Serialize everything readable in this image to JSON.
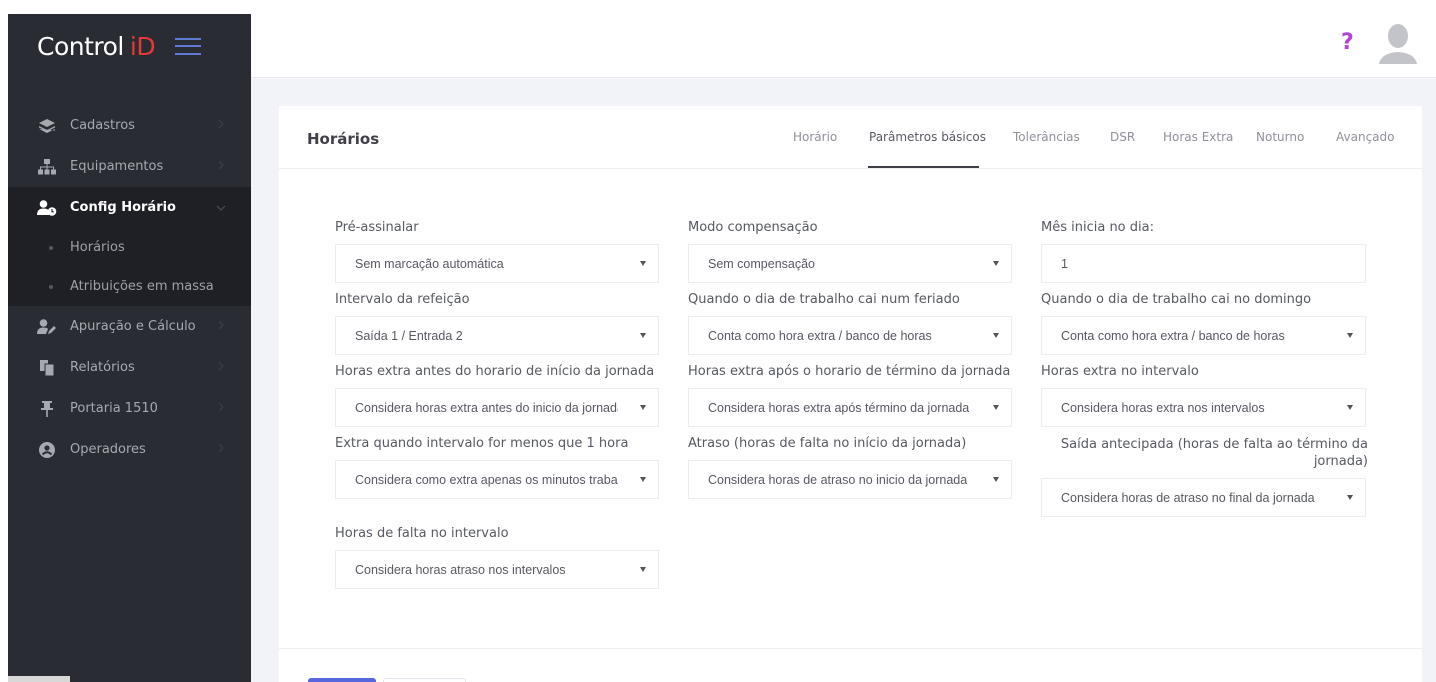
{
  "brand": {
    "name": "Control",
    "accent": "iD"
  },
  "sidebar": {
    "items": [
      {
        "label": "Cadastros",
        "icon": "layers-icon"
      },
      {
        "label": "Equipamentos",
        "icon": "sitemap-icon"
      },
      {
        "label": "Config Horário",
        "icon": "user-clock-icon"
      },
      {
        "label": "Apuração e Cálculo",
        "icon": "user-edit-icon"
      },
      {
        "label": "Relatórios",
        "icon": "copy-icon"
      },
      {
        "label": "Portaria 1510",
        "icon": "pin-icon"
      },
      {
        "label": "Operadores",
        "icon": "user-circle-icon"
      }
    ],
    "subitems": [
      {
        "label": "Horários"
      },
      {
        "label": "Atribuições em massa"
      }
    ]
  },
  "topbar": {
    "help": "?"
  },
  "card": {
    "title": "Horários",
    "tabs": [
      "Horário",
      "Parâmetros básicos",
      "Tolerâncias",
      "DSR",
      "Horas Extra",
      "Noturno",
      "Avançado"
    ],
    "active_tab": "Parâmetros básicos"
  },
  "form": {
    "pre_assinalar": {
      "label": "Pré-assinalar",
      "value": "Sem marcação automática"
    },
    "modo_compensacao": {
      "label": "Modo compensação",
      "value": "Sem compensação"
    },
    "mes_inicia": {
      "label": "Mês inicia no dia:",
      "value": "1"
    },
    "intervalo_refeicao": {
      "label": "Intervalo da refeição",
      "value": "Saída 1 / Entrada 2"
    },
    "feriado": {
      "label": "Quando o dia de trabalho cai num feriado",
      "value": "Conta como hora extra / banco de horas"
    },
    "domingo": {
      "label": "Quando o dia de trabalho cai no domingo",
      "value": "Conta como hora extra / banco de horas"
    },
    "extra_antes": {
      "label": "Horas extra antes do horario de início da jornada",
      "value": "Considera horas extra antes do inicio da jornada"
    },
    "extra_apos": {
      "label": "Horas extra após o horario de término da jornada",
      "value": "Considera horas extra após término da jornada"
    },
    "extra_intervalo": {
      "label": "Horas extra no intervalo",
      "value": "Considera horas extra nos intervalos"
    },
    "extra_menos_hora": {
      "label": "Extra quando intervalo for menos que 1 hora",
      "value": "Considera como extra apenas os minutos trabalhados"
    },
    "atraso": {
      "label": "Atraso (horas de falta no início da jornada)",
      "value": "Considera horas de atraso no inicio da jornada"
    },
    "saida_antecipada": {
      "label_line1": "Saída antecipada (horas de falta ao término da",
      "label_line2": "jornada)",
      "value": "Considera horas de atraso no final da jornada"
    },
    "falta_intervalo": {
      "label": "Horas de falta no intervalo",
      "value": "Considera horas atraso nos intervalos"
    }
  },
  "colors": {
    "accent": "#e53935",
    "primary": "#5867dd",
    "help": "#b243d8",
    "sidebar_bg": "#2a2c33"
  }
}
